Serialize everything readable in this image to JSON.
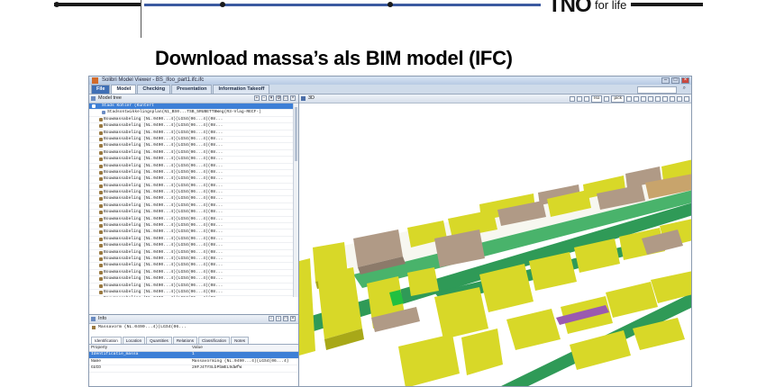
{
  "slide": {
    "title": "Download massa’s als BIM model (IFC)",
    "logo_text": "TNO",
    "logo_tagline": "for life"
  },
  "window": {
    "title": "Solibri Model Viewer - BS_lfoo_part1.ifc.ifc",
    "tabs": [
      "File",
      "Model",
      "Checking",
      "Presentation",
      "Information Takeoff"
    ],
    "active_tab": "Model",
    "search_placeholder": ""
  },
  "model_tree": {
    "header": "Model tree",
    "root_label": "Stads Kohler (Kuntert",
    "sub_label": "Stadsontwikkelingsplan(N1_BS0...TSB_5RUBETTBWeg(R3-Vlag-RECF-)",
    "items": [
      "Bouwmassabeling (NL.0490...4)(LGS4(06...4)(08...",
      "Bouwmassabeling (NL.0490...4)(LGS4(06...4)(08...",
      "Bouwmassabeling (NL.0490...4)(LGS4(06...4)(08...",
      "Bouwmassabeling (NL.0490...4)(LGS4(06...4)(08...",
      "Bouwmassabeling (NL.0490...4)(LGS4(06...4)(08...",
      "Bouwmassabeling (NL.0490...4)(LGS4(06...4)(08...",
      "Bouwmassabeling (NL.0490...4)(LGS4(06...4)(08...",
      "Bouwmassabeling (NL.0490...4)(LGS4(06...4)(08...",
      "Bouwmassabeling (NL.0490...4)(LGS4(06...4)(08...",
      "Bouwmassabeling (NL.0490...4)(LGS4(06...4)(08...",
      "Bouwmassabeling (NL.0490...4)(LGS4(06...4)(08...",
      "Bouwmassabeling (NL.0490...4)(LGS4(06...4)(08...",
      "Bouwmassabeling (NL.0490...4)(LGS4(06...4)(08...",
      "Bouwmassabeling (NL.0490...4)(LGS4(06...4)(08...",
      "Bouwmassabeling (NL.0490...4)(LGS4(06...4)(08...",
      "Bouwmassabeling (NL.0490...4)(LGS4(06...4)(08...",
      "Bouwmassabeling (NL.0490...4)(LGS4(06...4)(08...",
      "Bouwmassabeling (NL.0490...4)(LGS4(06...4)(08...",
      "Bouwmassabeling (NL.0490...4)(LGS4(06...4)(08...",
      "Bouwmassabeling (NL.0490...4)(LGS4(06...4)(08...",
      "Bouwmassabeling (NL.0490...4)(LGS4(06...4)(08...",
      "Bouwmassabeling (NL.0490...4)(LGS4(06...4)(08...",
      "Bouwmassabeling (NL.0490...4)(LGS4(06...4)(08...",
      "Bouwmassabeling (NL.0490...4)(LGS4(06...4)(08...",
      "Bouwmassabeling (NL.0490...4)(LGS4(06...4)(08...",
      "Bouwmassabeling (NL.0490...4)(LGS4(06...4)(08...",
      "Bouwmassabeling (NL.0490...4)(LGS4(06...4)(08...",
      "Bouwmassabeling (NL.0490...4)(LGS4(06...4)(08...",
      "Bouwmassabeling (NL.0490...4)(LGS4(06...4)(08...",
      "Bouwmassabeling (NL.0490...4)(LGS4(06...4)(08...",
      "Bouwmassabeling (NL.0490...4)(LGS4(06...4)(08..."
    ]
  },
  "info_panel": {
    "header": "Info",
    "selected": "Massavorm (NL.0490...4)(LGS4(06...",
    "tabs": [
      "Identification",
      "Location",
      "Quantities",
      "Relations",
      "Classification",
      "Notes"
    ],
    "active_tab": "Identification",
    "columns": [
      "Property",
      "Value"
    ],
    "rows": [
      [
        "Identificatie_massa",
        "1"
      ],
      [
        "Name",
        "Massavorming (NL.0490...4)(LGS4(06...4)"
      ],
      [
        "GUID",
        "2HFJ4TYSLbPbWEL9dWfW"
      ]
    ]
  },
  "viewport": {
    "header": "3D",
    "view_select": "Iso",
    "mode_select": "pick"
  },
  "colors": {
    "building_yellow": "#d8d828",
    "building_brown": "#b09a86",
    "roads_green": "#2f9a57",
    "highlight_green": "#22c040",
    "highlight_purple": "#9a5ab0",
    "selection_blue": "#3d7fd6"
  }
}
